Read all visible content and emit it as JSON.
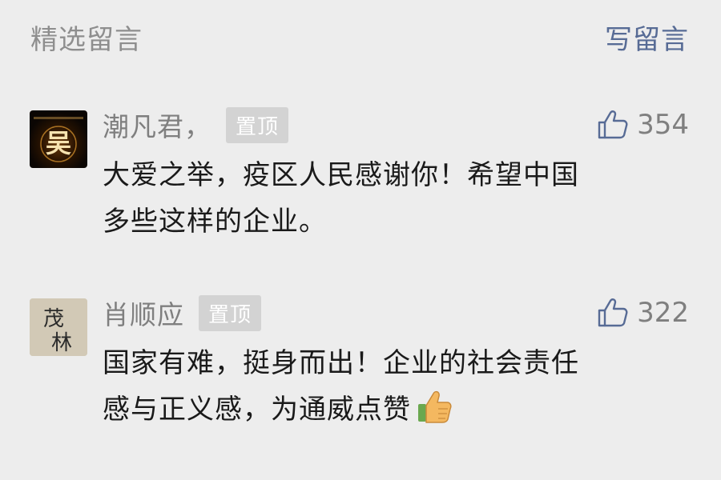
{
  "header": {
    "title": "精选留言",
    "write_label": "写留言"
  },
  "comments": [
    {
      "nickname": "潮凡君，",
      "pin_label": "置顶",
      "likes": "354",
      "lines": [
        "大爱之举，疫区人民感谢你！希望中国",
        "多些这样的企业。"
      ],
      "avatar_text": "吴"
    },
    {
      "nickname": "肖顺应",
      "pin_label": "置顶",
      "likes": "322",
      "lines": [
        "国家有难，挺身而出！企业的社会责任",
        "感与正义感，为通威点赞"
      ],
      "avatar_text": [
        "茂",
        "林"
      ]
    }
  ],
  "colors": {
    "background": "#ededed",
    "link": "#576b95",
    "meta_text": "#7f7f7f",
    "badge": "#d3d3d3"
  },
  "icons": {
    "like": "thumbs-up-outline-icon",
    "emoji": "thumbs-up-emoji-icon"
  }
}
